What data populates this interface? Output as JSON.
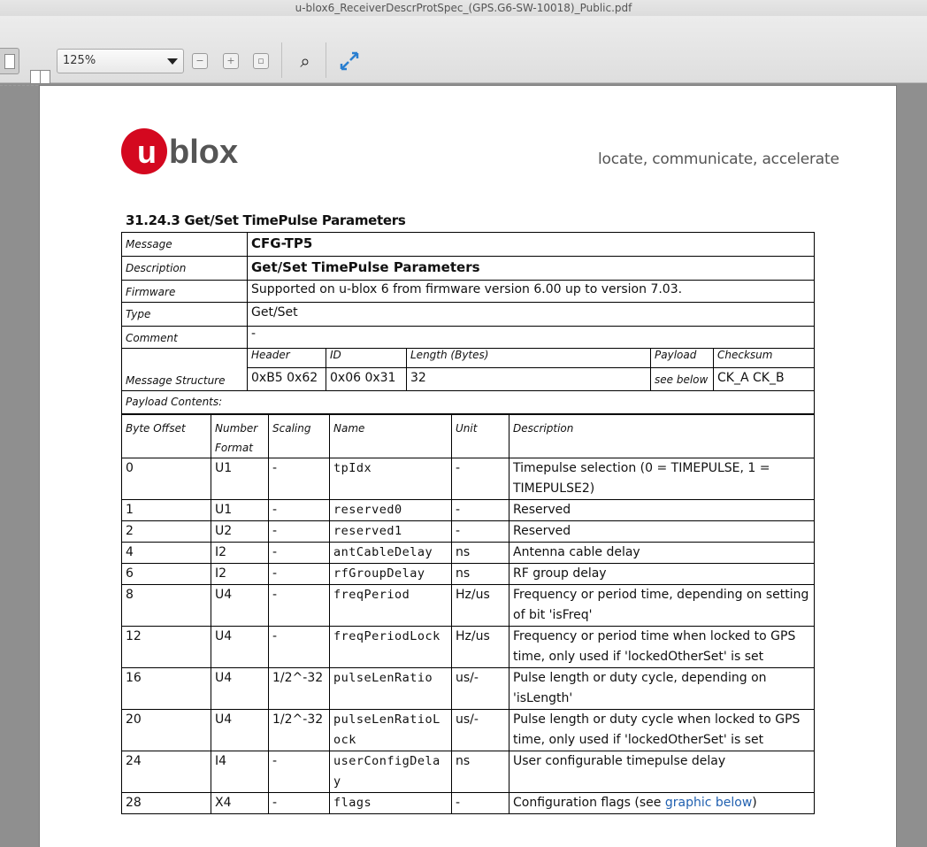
{
  "window": {
    "title": "u-blox6_ReceiverDescrProtSpec_(GPS.G6-SW-10018)_Public.pdf"
  },
  "toolbar": {
    "zoom_value": "125%",
    "zoom_out_icon": "zoom-out-icon",
    "zoom_in_icon": "zoom-in-icon"
  },
  "header": {
    "logo_text": "ublox",
    "tagline": "locate, communicate, accelerate"
  },
  "section": {
    "title": "31.24.3 Get/Set TimePulse Parameters"
  },
  "message": {
    "message_label": "Message",
    "message_value": "CFG-TP5",
    "description_label": "Description",
    "description_value": "Get/Set TimePulse Parameters",
    "firmware_label": "Firmware",
    "firmware_value": "Supported on u-blox 6 from firmware version 6.00 up to version 7.03.",
    "type_label": "Type",
    "type_value": "Get/Set",
    "comment_label": "Comment",
    "comment_value": "-",
    "structure_label": "Message Structure",
    "header_label": "Header",
    "header_value": "0xB5 0x62",
    "id_label": "ID",
    "id_value": "0x06 0x31",
    "length_label": "Length (Bytes)",
    "length_value": "32",
    "payload_label": "Payload",
    "payload_value": "see below",
    "checksum_label": "Checksum",
    "checksum_value": "CK_A CK_B",
    "payload_contents_label": "Payload Contents:"
  },
  "payload": {
    "columns": [
      "Byte Offset",
      "Number Format",
      "Scaling",
      "Name",
      "Unit",
      "Description"
    ],
    "rows": [
      {
        "offset": "0",
        "format": "U1",
        "scaling": "-",
        "name": "tpIdx",
        "unit": "-",
        "desc": "Timepulse selection (0 = TIMEPULSE, 1 = TIMEPULSE2)"
      },
      {
        "offset": "1",
        "format": "U1",
        "scaling": "-",
        "name": "reserved0",
        "unit": "-",
        "desc": "Reserved"
      },
      {
        "offset": "2",
        "format": "U2",
        "scaling": "-",
        "name": "reserved1",
        "unit": "-",
        "desc": "Reserved"
      },
      {
        "offset": "4",
        "format": "I2",
        "scaling": "-",
        "name": "antCableDelay",
        "unit": "ns",
        "desc": "Antenna cable delay"
      },
      {
        "offset": "6",
        "format": "I2",
        "scaling": "-",
        "name": "rfGroupDelay",
        "unit": "ns",
        "desc": "RF group delay"
      },
      {
        "offset": "8",
        "format": "U4",
        "scaling": "-",
        "name": "freqPeriod",
        "unit": "Hz/us",
        "desc": "Frequency or period time, depending on setting of bit 'isFreq'"
      },
      {
        "offset": "12",
        "format": "U4",
        "scaling": "-",
        "name": "freqPeriodLock",
        "unit": "Hz/us",
        "desc": "Frequency or period time when locked to GPS time, only used if 'lockedOtherSet' is set"
      },
      {
        "offset": "16",
        "format": "U4",
        "scaling": "1/2^-32",
        "name": "pulseLenRatio",
        "unit": "us/-",
        "desc": "Pulse length or duty cycle, depending on 'isLength'"
      },
      {
        "offset": "20",
        "format": "U4",
        "scaling": "1/2^-32",
        "name": "pulseLenRatioLock",
        "unit": "us/-",
        "desc": "Pulse length or duty cycle when locked to GPS time, only used if 'lockedOtherSet' is set"
      },
      {
        "offset": "24",
        "format": "I4",
        "scaling": "-",
        "name": "userConfigDelay",
        "unit": "ns",
        "desc": "User configurable timepulse delay"
      },
      {
        "offset": "28",
        "format": "X4",
        "scaling": "-",
        "name": "flags",
        "unit": "-",
        "desc_prefix": "Configuration flags (see ",
        "desc_link": "graphic below",
        "desc_suffix": ")"
      }
    ]
  }
}
